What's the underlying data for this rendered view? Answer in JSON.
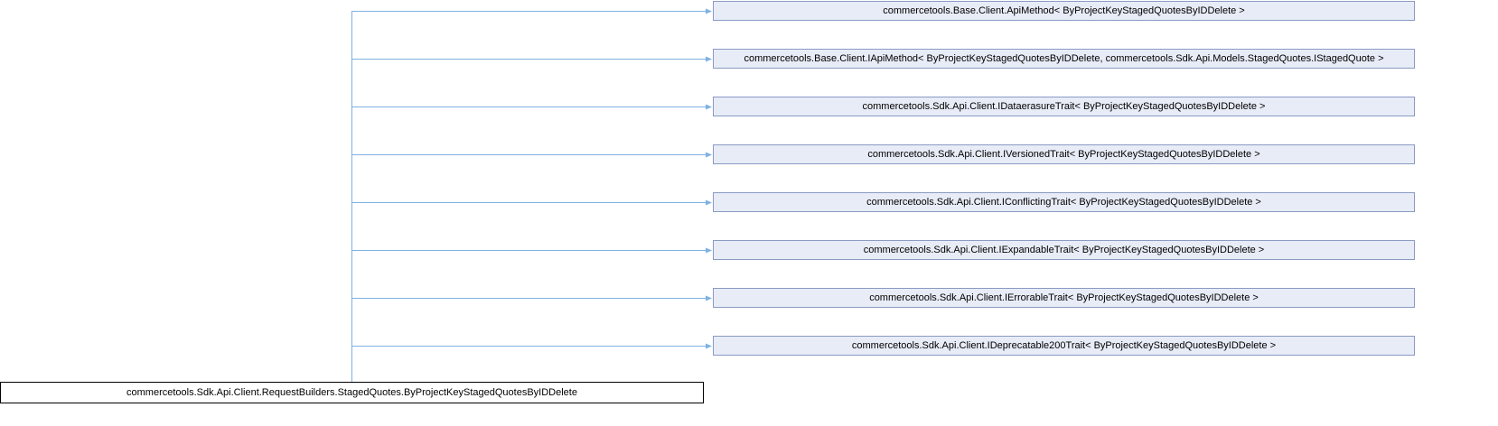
{
  "diagram": {
    "base_classes": [
      "commercetools.Base.Client.ApiMethod< ByProjectKeyStagedQuotesByIDDelete >",
      "commercetools.Base.Client.IApiMethod< ByProjectKeyStagedQuotesByIDDelete, commercetools.Sdk.Api.Models.StagedQuotes.IStagedQuote >",
      "commercetools.Sdk.Api.Client.IDataerasureTrait< ByProjectKeyStagedQuotesByIDDelete >",
      "commercetools.Sdk.Api.Client.IVersionedTrait< ByProjectKeyStagedQuotesByIDDelete >",
      "commercetools.Sdk.Api.Client.IConflictingTrait< ByProjectKeyStagedQuotesByIDDelete >",
      "commercetools.Sdk.Api.Client.IExpandableTrait< ByProjectKeyStagedQuotesByIDDelete >",
      "commercetools.Sdk.Api.Client.IErrorableTrait< ByProjectKeyStagedQuotesByIDDelete >",
      "commercetools.Sdk.Api.Client.IDeprecatable200Trait< ByProjectKeyStagedQuotesByIDDelete >"
    ],
    "derived_class": "commercetools.Sdk.Api.Client.RequestBuilders.StagedQuotes.ByProjectKeyStagedQuotesByIDDelete",
    "colors": {
      "edge": "#7fb1e3",
      "base_fill": "#e8ecf7",
      "base_border": "#8a9ac4",
      "derived_border": "#000000"
    }
  }
}
